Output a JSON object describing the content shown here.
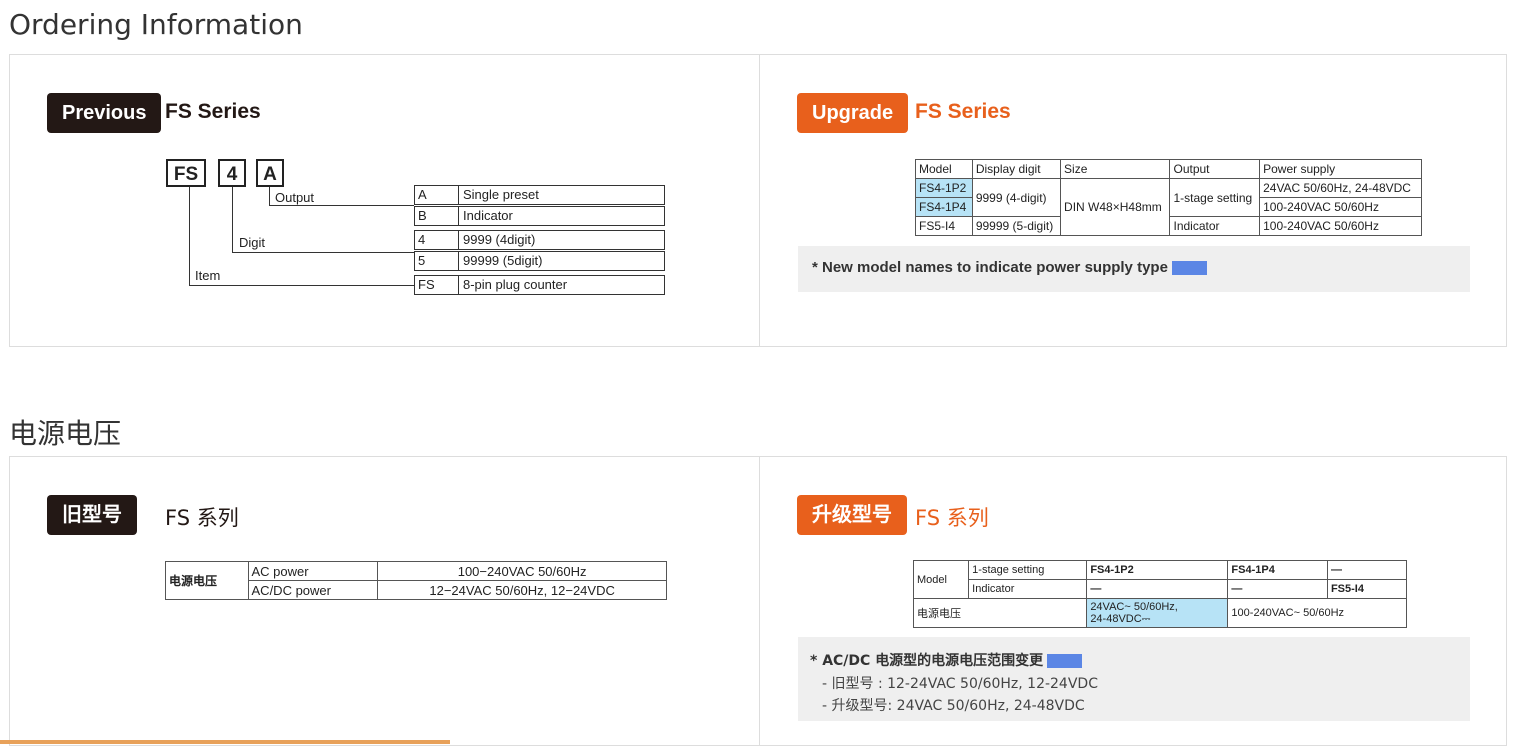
{
  "sections": {
    "ordering": {
      "title": "Ordering Information",
      "previous": {
        "badge": "Previous",
        "series": "FS Series",
        "code": [
          "FS",
          "4",
          "A"
        ],
        "labels": {
          "output": "Output",
          "digit": "Digit",
          "item": "Item"
        },
        "options": [
          {
            "key": "A",
            "value": "Single preset"
          },
          {
            "key": "B",
            "value": "Indicator"
          },
          {
            "key": "4",
            "value": "9999 (4digit)"
          },
          {
            "key": "5",
            "value": "99999 (5digit)"
          },
          {
            "key": "FS",
            "value": "8-pin plug counter"
          }
        ]
      },
      "upgrade": {
        "badge": "Upgrade",
        "series": "FS Series",
        "table": {
          "headers": [
            "Model",
            "Display digit",
            "Size",
            "Output",
            "Power supply"
          ],
          "models": [
            "FS4-1P2",
            "FS4-1P4",
            "FS5-I4"
          ],
          "digits": [
            "9999 (4-digit)",
            "99999 (5-digit)"
          ],
          "size": "DIN W48×H48mm",
          "outputs": [
            "1-stage setting",
            "Indicator"
          ],
          "power": [
            "24VAC 50/60Hz, 24-48VDC",
            "100-240VAC 50/60Hz",
            "100-240VAC 50/60Hz"
          ]
        },
        "note": "* New model names to indicate power supply type",
        "highlight_color": "#5b86e5"
      }
    },
    "power": {
      "title": "电源电压",
      "previous": {
        "badge": "旧型号",
        "series": "FS 系列",
        "table": {
          "label": "电源电压",
          "rows": [
            {
              "type": "AC power",
              "value": "100−240VAC 50/60Hz"
            },
            {
              "type": "AC/DC power",
              "value": "12−24VAC 50/60Hz, 12−24VDC"
            }
          ]
        }
      },
      "upgrade": {
        "badge": "升级型号",
        "series": "FS 系列",
        "table": {
          "model_label": "Model",
          "row1_label": "1-stage setting",
          "row2_label": "Indicator",
          "row1": [
            "FS4-1P2",
            "FS4-1P4",
            "—"
          ],
          "row2": [
            "—",
            "—",
            "FS5-I4"
          ],
          "voltage_label": "电源电压",
          "voltage_1": "24VAC~ 50/60Hz,",
          "voltage_1b": "24-48VDC⎓",
          "voltage_2": "100-240VAC~ 50/60Hz"
        },
        "note_title": "* AC/DC 电源型的电源电压范围变更",
        "note_lines": [
          "- 旧型号 : 12-24VAC 50/60Hz, 12-24VDC",
          "- 升级型号: 24VAC 50/60Hz, 24-48VDC"
        ]
      }
    }
  },
  "colors": {
    "accent": "#e8601c",
    "dark": "#231815",
    "highlight": "#b7e3f6",
    "note_bg": "#efefef"
  }
}
